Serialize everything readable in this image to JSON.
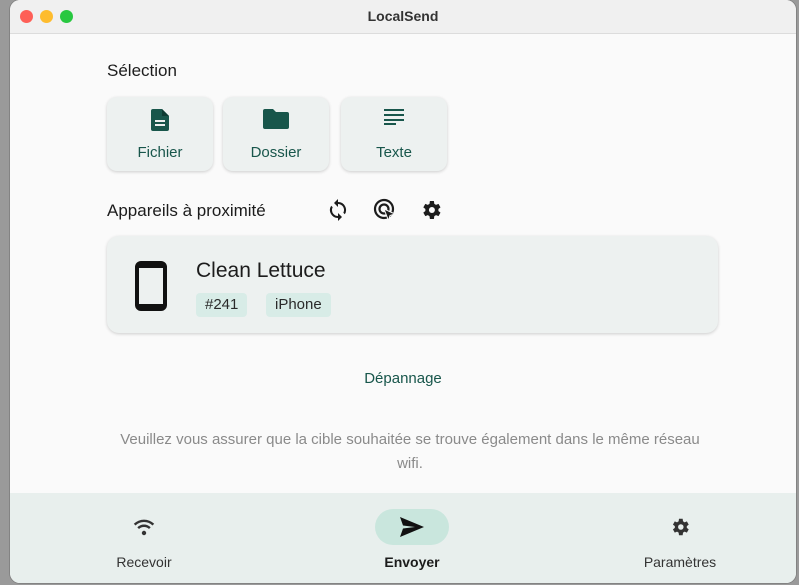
{
  "window": {
    "title": "LocalSend"
  },
  "selection": {
    "heading": "Sélection",
    "buttons": [
      {
        "label": "Fichier",
        "icon": "file-icon"
      },
      {
        "label": "Dossier",
        "icon": "folder-icon"
      },
      {
        "label": "Texte",
        "icon": "text-icon"
      }
    ]
  },
  "nearby": {
    "heading": "Appareils à proximité",
    "actions": [
      "refresh-icon",
      "target-icon",
      "gear-icon"
    ]
  },
  "device": {
    "name": "Clean Lettuce",
    "tag_id": "#241",
    "tag_type": "iPhone",
    "icon": "smartphone-icon"
  },
  "troubleshoot_label": "Dépannage",
  "hint": "Veuillez vous assurer que la cible souhaitée se trouve également dans le même réseau wifi.",
  "nav": {
    "receive": "Recevoir",
    "send": "Envoyer",
    "settings": "Paramètres"
  },
  "colors": {
    "accent": "#18564b",
    "nav_active_bg": "#c9e6dd",
    "card_bg": "#edf1f0"
  }
}
